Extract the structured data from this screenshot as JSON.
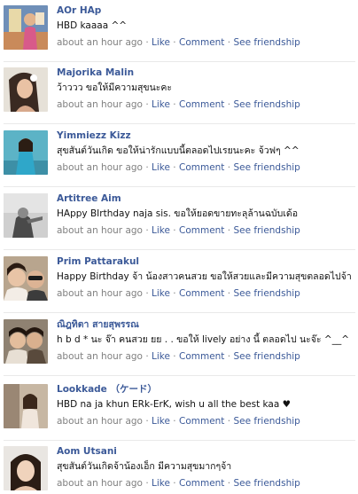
{
  "posts": [
    {
      "name": "AOr HAp",
      "message": "HBD kaaaa ^^",
      "time": "about an hour ago",
      "like": "Like",
      "comment": "Comment",
      "friendship": "See friendship",
      "separator": "·"
    },
    {
      "name": "Majorika Malin",
      "message": "ว้าววว ขอให้มีความสุขนะคะ",
      "time": "about an hour ago",
      "like": "Like",
      "comment": "Comment",
      "friendship": "See friendship",
      "separator": "·"
    },
    {
      "name": "Yimmiezz Kizz",
      "message": "สุขสันต์วันเกิด ขอให้น่ารักแบบนี้ตลอดไปเรยนะคะ จ้วฟๆ ^^",
      "time": "about an hour ago",
      "like": "Like",
      "comment": "Comment",
      "friendship": "See friendship",
      "separator": "·"
    },
    {
      "name": "Artitree Aim",
      "message": "HAppy BIrthday naja sis. ขอให้ยอดขายทะลุล้านฉบับเด้อ",
      "time": "about an hour ago",
      "like": "Like",
      "comment": "Comment",
      "friendship": "See friendship",
      "separator": "·"
    },
    {
      "name": "Prim Pattarakul",
      "message": "Happy Birthday จ้า น้องสาวคนสวย ขอให้สวยและมีความสุขตลอดไปจ้า",
      "time": "about an hour ago",
      "like": "Like",
      "comment": "Comment",
      "friendship": "See friendship",
      "separator": "·"
    },
    {
      "name": "ณิฎทิตา สายสุพรรณ",
      "message": "h b d * นะ จ๊า คนสวย ยย . . ขอให้ lively อย่าง นี้ ตลอดไป นะจ๊ะ ^__^",
      "time": "about an hour ago",
      "like": "Like",
      "comment": "Comment",
      "friendship": "See friendship",
      "separator": "·"
    },
    {
      "name": "Lookkade （ケード）",
      "message": "HBD na ja khun ERk-ErK, wish u all the best kaa ♥",
      "time": "about an hour ago",
      "like": "Like",
      "comment": "Comment",
      "friendship": "See friendship",
      "separator": "·"
    },
    {
      "name": "Aom Utsani",
      "message": "สุขสันต์วันเกิดจ้าน้องเอ็ก มีความสุขมากๆจ้า",
      "time": "about an hour ago",
      "like": "Like",
      "comment": "Comment",
      "friendship": "See friendship",
      "separator": "·"
    }
  ],
  "colors": {
    "link": "#3b5998",
    "meta": "#808080",
    "text": "#111111",
    "divider": "#e9e9e9"
  }
}
